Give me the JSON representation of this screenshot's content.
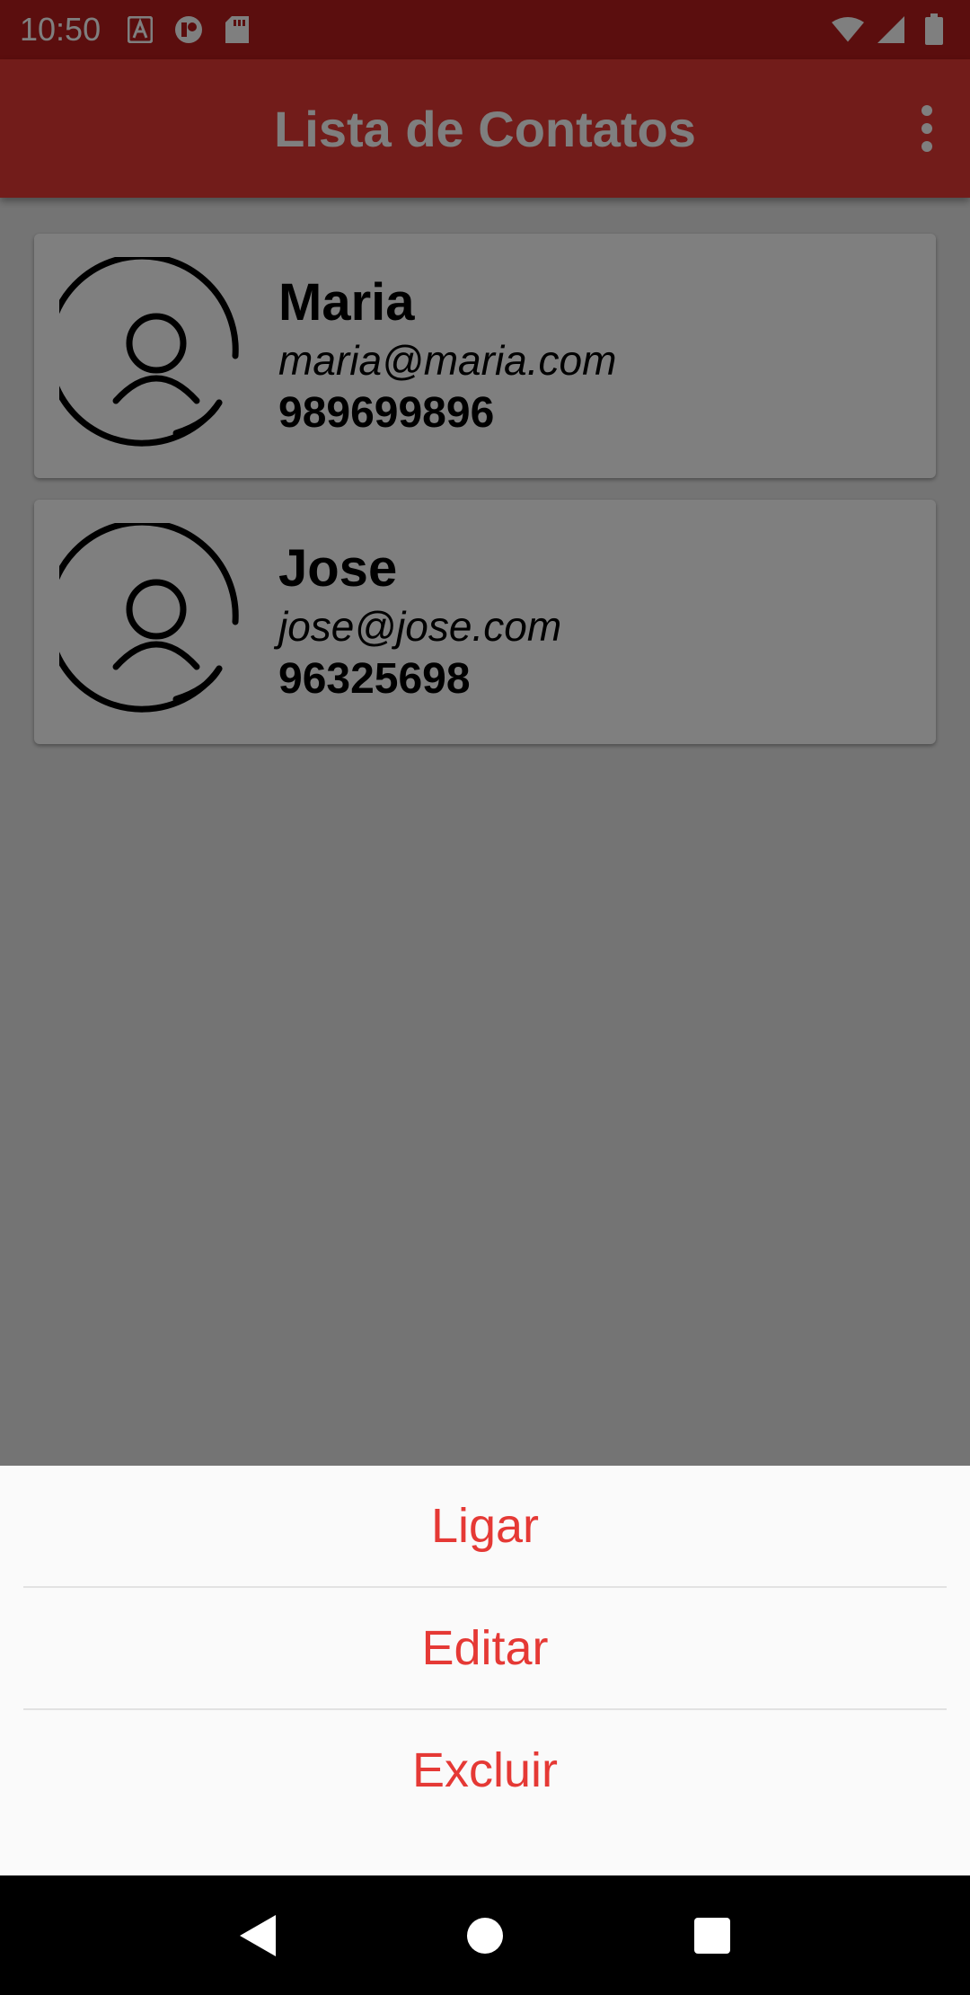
{
  "status_bar": {
    "time": "10:50",
    "left_icons": [
      "pdf-notification-icon",
      "app-notification-icon",
      "sd-card-icon"
    ],
    "right_icons": [
      "wifi-icon",
      "signal-icon",
      "battery-icon"
    ]
  },
  "app_bar": {
    "title": "Lista de Contatos",
    "overflow_icon": "more-vert-icon"
  },
  "contacts": [
    {
      "name": "Maria",
      "email": "maria@maria.com",
      "phone": "989699896"
    },
    {
      "name": "Jose",
      "email": "jose@jose.com",
      "phone": "96325698"
    }
  ],
  "bottom_sheet": {
    "options": [
      "Ligar",
      "Editar",
      "Excluir"
    ]
  },
  "nav_bar": {
    "icons": [
      "back-icon",
      "home-icon",
      "recents-icon"
    ]
  },
  "colors": {
    "primary": "#e53935",
    "status_bar": "#b71c1c",
    "sheet_background": "#fafafa",
    "option_text": "#e53935"
  }
}
